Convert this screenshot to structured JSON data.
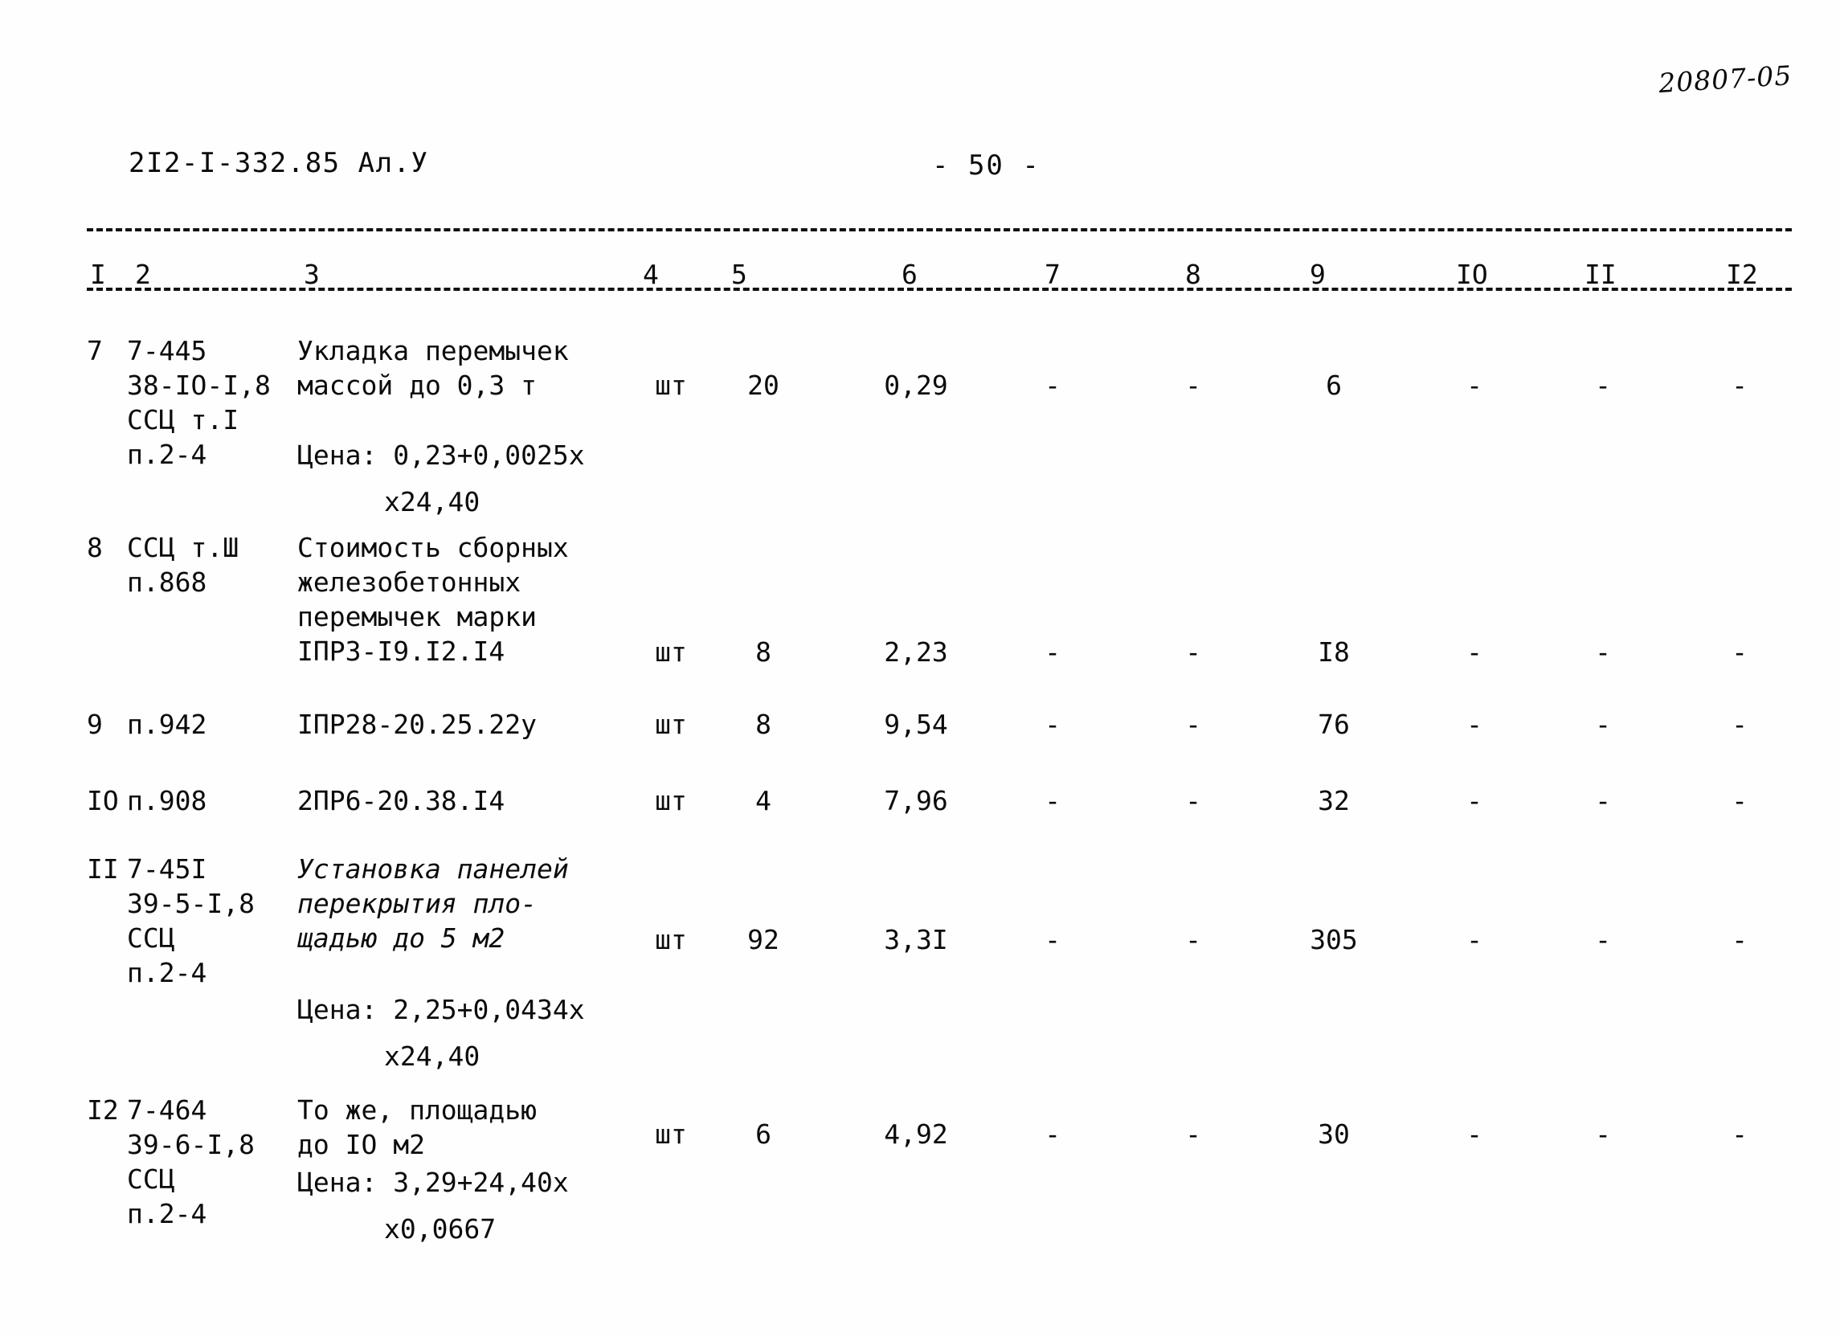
{
  "header": {
    "doc_code": "2I2-I-332.85 Ал.У",
    "page_number": "- 50 -",
    "archive_mark": "20807-05"
  },
  "table": {
    "column_headers": [
      "I",
      "2",
      "3",
      "4",
      "5",
      "6",
      "7",
      "8",
      "9",
      "IO",
      "II",
      "I2"
    ],
    "rows": [
      {
        "num": "7",
        "code_lines": [
          "7-445",
          "38-IO-I,8",
          "ССЦ т.I",
          "п.2-4"
        ],
        "desc_lines": [
          "Укладка перемычек",
          "массой до 0,3 т"
        ],
        "desc_italic": false,
        "price_lines": [
          "Цена: 0,23+0,0025х",
          "х24,40"
        ],
        "unit": "шт",
        "qty": "20",
        "v6": "0,29",
        "v7": "-",
        "v8": "-",
        "v9": "6",
        "v10": "-",
        "v11": "-",
        "v12": "-"
      },
      {
        "num": "8",
        "code_lines": [
          "ССЦ т.Ш",
          "п.868"
        ],
        "desc_lines": [
          "Стоимость сборных",
          "железобетонных",
          "перемычек марки",
          "IПР3-I9.I2.I4"
        ],
        "desc_italic": false,
        "price_lines": [],
        "unit": "шт",
        "qty": "8",
        "v6": "2,23",
        "v7": "-",
        "v8": "-",
        "v9": "I8",
        "v10": "-",
        "v11": "-",
        "v12": "-"
      },
      {
        "num": "9",
        "code_lines": [
          "п.942"
        ],
        "desc_lines": [
          "IПР28-20.25.22у"
        ],
        "desc_italic": false,
        "price_lines": [],
        "unit": "шт",
        "qty": "8",
        "v6": "9,54",
        "v7": "-",
        "v8": "-",
        "v9": "76",
        "v10": "-",
        "v11": "-",
        "v12": "-"
      },
      {
        "num": "IO",
        "code_lines": [
          "п.908"
        ],
        "desc_lines": [
          "2ПР6-20.38.I4"
        ],
        "desc_italic": false,
        "price_lines": [],
        "unit": "шт",
        "qty": "4",
        "v6": "7,96",
        "v7": "-",
        "v8": "-",
        "v9": "32",
        "v10": "-",
        "v11": "-",
        "v12": "-"
      },
      {
        "num": "II",
        "code_lines": [
          "7-45I",
          "39-5-I,8",
          "ССЦ",
          "п.2-4"
        ],
        "desc_lines": [
          "Установка панелей",
          "перекрытия пло-",
          "щадью до 5 м2"
        ],
        "desc_italic": true,
        "price_lines": [
          "Цена: 2,25+0,0434х",
          "х24,40"
        ],
        "unit": "шт",
        "qty": "92",
        "v6": "3,3I",
        "v7": "-",
        "v8": "-",
        "v9": "305",
        "v10": "-",
        "v11": "-",
        "v12": "-"
      },
      {
        "num": "I2",
        "code_lines": [
          "7-464",
          "39-6-I,8",
          "ССЦ",
          "п.2-4"
        ],
        "desc_lines": [
          "То же, площадью",
          "до IO м2"
        ],
        "desc_italic": false,
        "price_lines": [
          "Цена: 3,29+24,40х",
          "х0,0667"
        ],
        "unit": "шт",
        "qty": "6",
        "v6": "4,92",
        "v7": "-",
        "v8": "-",
        "v9": "30",
        "v10": "-",
        "v11": "-",
        "v12": "-"
      }
    ]
  }
}
